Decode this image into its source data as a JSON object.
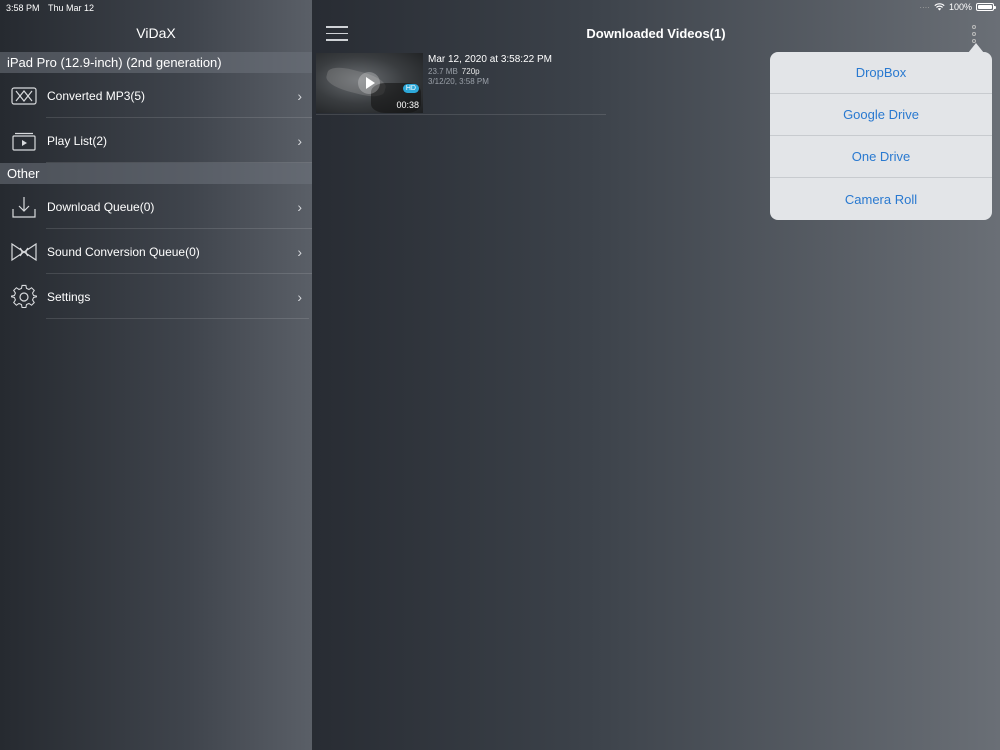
{
  "status_bar": {
    "time": "3:58 PM",
    "date": "Thu Mar 12",
    "battery": "100%"
  },
  "sidebar": {
    "title": "ViDaX",
    "sections": [
      {
        "header": "iPad Pro (12.9-inch) (2nd generation)",
        "items": [
          {
            "label": "Converted MP3(5)",
            "icon": "music-conversion-icon"
          },
          {
            "label": "Play List(2)",
            "icon": "playlist-icon"
          }
        ]
      },
      {
        "header": "Other",
        "items": [
          {
            "label": "Download Queue(0)",
            "icon": "download-icon"
          },
          {
            "label": "Sound Conversion Queue(0)",
            "icon": "sound-conversion-icon"
          },
          {
            "label": "Settings",
            "icon": "gear-icon"
          }
        ]
      }
    ]
  },
  "main": {
    "title": "Downloaded Videos(1)",
    "videos": [
      {
        "title": "Mar 12, 2020 at 3:58:22 PM",
        "size": "23.7 MB",
        "resolution": "720p",
        "date": "3/12/20, 3:58 PM",
        "duration": "00:38",
        "badge": "HD"
      }
    ]
  },
  "popover": {
    "items": [
      "DropBox",
      "Google Drive",
      "One Drive",
      "Camera Roll"
    ]
  },
  "colors": {
    "accent": "#2979d0",
    "hd_badge": "#2da8d8"
  }
}
